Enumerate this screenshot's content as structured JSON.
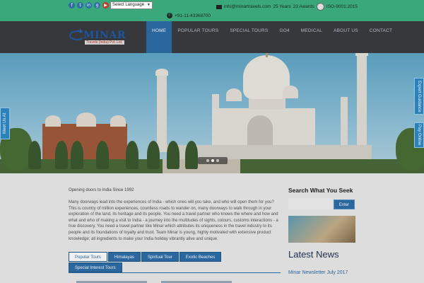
{
  "topbar": {
    "social_icons": [
      "facebook-icon",
      "twitter-icon",
      "linkedin-icon",
      "google-plus-icon",
      "youtube-icon"
    ],
    "language_select": "Select Language",
    "email": "info@minartravels.com",
    "years": "25 Years",
    "awards": "23 Awards",
    "iso": "ISO-9001:2015",
    "phone": "+91-11-43368700"
  },
  "brand": {
    "name": "MINAR",
    "tagline": "Travels (India) Pvt. Ltd."
  },
  "nav": {
    "items": [
      "HOME",
      "POPULAR TOURS",
      "SPECIAL TOURS",
      "GO4",
      "MEDICAL",
      "ABOUT US",
      "CONTACT"
    ]
  },
  "side_tabs": {
    "left": "Meet Us At",
    "right_top": "Expert Guidance",
    "right_bottom": "Pay Online"
  },
  "intro": {
    "title": "Opening doors to India Since 1992",
    "text": "Many doorways lead into the experiences of India - which ones will you take, and who will open them for you? This is country of million experiences, countless roads to wander on, many doorways to walk through in your exploration of the land, its heritage and its people. You need a travel partner who knows the where and how and what and who of making a visit to India - a journey into the multitudes of sights, colours, customs interactions - a true discovery. You need a travel partner like Minar which attributes its uniqueness in the travel industry to its people and its foundations of loyalty and trust. Team Minar is young, highly motivated with extensive product knowledge; all ingredients to make your India holiday vibrantly alive and unique."
  },
  "tabs": [
    "Popular Tours",
    "Himalayas",
    "Spiritual Tour",
    "Exotic Beaches",
    "Special Interest Tours"
  ],
  "sidebar": {
    "search_title": "Search What You Seek",
    "search_button": "Enter",
    "news_title": "Latest News",
    "news_item": "Minar Newsletter July 2017"
  }
}
